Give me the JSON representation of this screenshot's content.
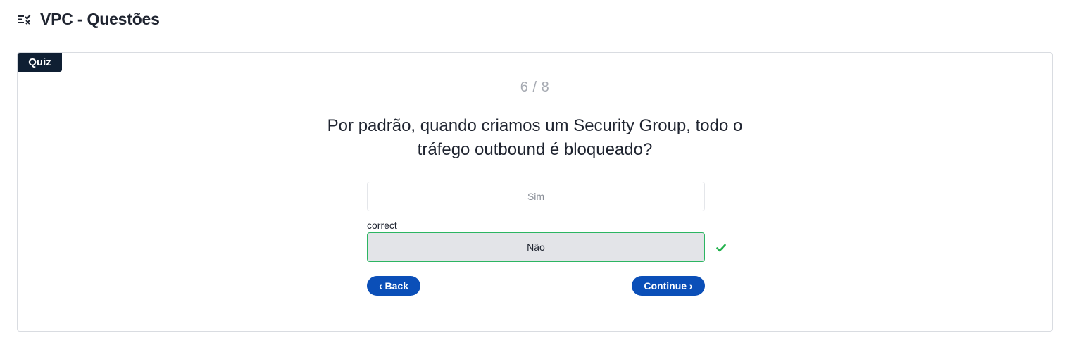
{
  "header": {
    "title": "VPC - Questões",
    "icon": "checklist-icon"
  },
  "quiz": {
    "badge": "Quiz",
    "progress": "6 / 8",
    "question_line1": "Por padrão, quando criamos um Security Group, todo o",
    "question_line2": "tráfego outbound é bloqueado?",
    "answers": [
      {
        "label": "Sim",
        "state": "unselected"
      },
      {
        "label": "Não",
        "state": "correct"
      }
    ],
    "correct_label": "correct",
    "back_label": "‹ Back",
    "continue_label": "Continue ›"
  },
  "colors": {
    "badge_bg": "#0f1f33",
    "button_bg": "#0b4fb8",
    "correct_border": "#2cb562",
    "check": "#22b14c"
  }
}
